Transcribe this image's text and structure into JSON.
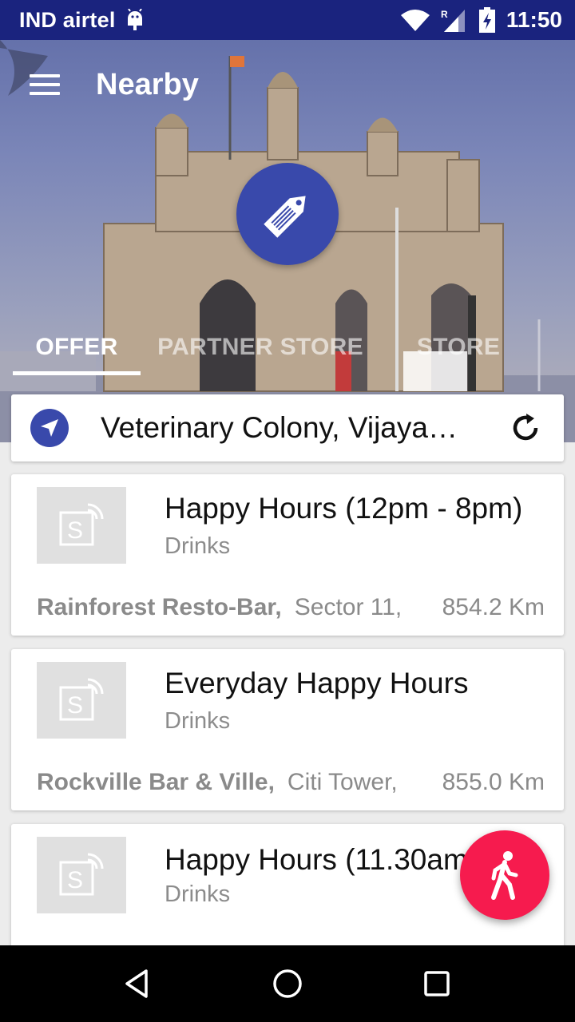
{
  "status_bar": {
    "carrier": "IND airtel",
    "time": "11:50",
    "network_letter": "R"
  },
  "toolbar": {
    "title": "Nearby",
    "menu_icon": "hamburger-menu-icon"
  },
  "tabs": [
    {
      "label": "OFFER",
      "active": true
    },
    {
      "label": "PARTNER STORE",
      "active": false
    },
    {
      "label": "STORE",
      "active": false
    }
  ],
  "location": {
    "text": "Veterinary Colony, Vijayawada",
    "icon": "navigation-arrow-icon",
    "refresh_icon": "refresh-icon"
  },
  "offers": [
    {
      "title": "Happy Hours (12pm - 8pm)",
      "category": "Drinks",
      "store": "Rainforest Resto-Bar,",
      "area": "Sector 11,",
      "distance": "854.2 Km"
    },
    {
      "title": "Everyday Happy Hours",
      "category": "Drinks",
      "store": "Rockville Bar & Ville,",
      "area": "Citi Tower,",
      "distance": "855.0 Km"
    },
    {
      "title": "Happy Hours  (11.30am",
      "category": "Drinks"
    }
  ],
  "fab": {
    "icon": "walking-person-icon"
  },
  "colors": {
    "status_bar": "#1a237e",
    "accent": "#3949ab",
    "fab": "#f61b4e",
    "navbar": "#000000"
  }
}
